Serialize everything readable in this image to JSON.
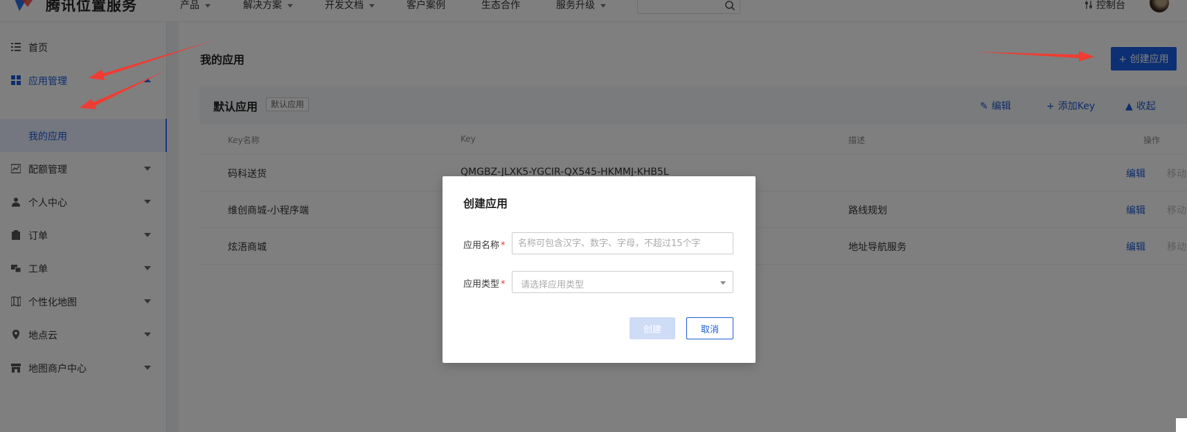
{
  "header": {
    "brand": "腾讯位置服务",
    "nav": [
      {
        "label": "产品",
        "caret": true
      },
      {
        "label": "解决方案",
        "caret": true
      },
      {
        "label": "开发文档",
        "caret": true
      },
      {
        "label": "客户案例",
        "caret": false
      },
      {
        "label": "生态合作",
        "caret": false
      },
      {
        "label": "服务升级",
        "caret": true
      }
    ],
    "console": "控制台"
  },
  "sidebar": {
    "items": [
      {
        "label": "首页",
        "icon": "list-icon"
      },
      {
        "label": "应用管理",
        "icon": "grid-icon"
      },
      {
        "label": "配额管理",
        "icon": "chart-icon"
      },
      {
        "label": "个人中心",
        "icon": "user-icon"
      },
      {
        "label": "订单",
        "icon": "clipboard-icon"
      },
      {
        "label": "工单",
        "icon": "ticket-icon"
      },
      {
        "label": "个性化地图",
        "icon": "map-icon"
      },
      {
        "label": "地点云",
        "icon": "location-icon"
      },
      {
        "label": "地图商户中心",
        "icon": "store-icon"
      }
    ],
    "submenu_label": "我的应用"
  },
  "main": {
    "title": "我的应用",
    "create_button": "+ 创建应用",
    "app": {
      "name": "默认应用",
      "tag": "默认应用",
      "actions": {
        "edit": "编辑",
        "add_key": "添加Key",
        "collapse": "收起"
      }
    },
    "table": {
      "headers": {
        "name": "Key名称",
        "key": "Key",
        "desc": "描述",
        "ops": "操作"
      },
      "rows": [
        {
          "name": "码科送货",
          "key": "QMGBZ-JLXK5-YGCIR-QX545-HKMMJ-KHB5L",
          "desc": "",
          "edit": "编辑",
          "move": "移动"
        },
        {
          "name": "维创商城-小程序端",
          "key": "",
          "desc": "路线规划",
          "edit": "编辑",
          "move": "移动"
        },
        {
          "name": "炫浯商城",
          "key": "",
          "desc": "地址导航服务",
          "edit": "编辑",
          "move": "移动"
        }
      ]
    }
  },
  "dialog": {
    "title": "创建应用",
    "name_label": "应用名称",
    "required_mark": "*",
    "name_placeholder": "名称可包含汉字、数字、字母，不超过15个字",
    "name_value": "",
    "type_label": "应用类型",
    "type_placeholder": "请选择应用类型",
    "create_button": "创建",
    "cancel_button": "取消"
  },
  "colors": {
    "primary": "#1b5ee6",
    "link": "#1a5bd6",
    "annotation_arrow": "#f03c32",
    "overlay": "rgba(0,0,0,0.5)"
  }
}
